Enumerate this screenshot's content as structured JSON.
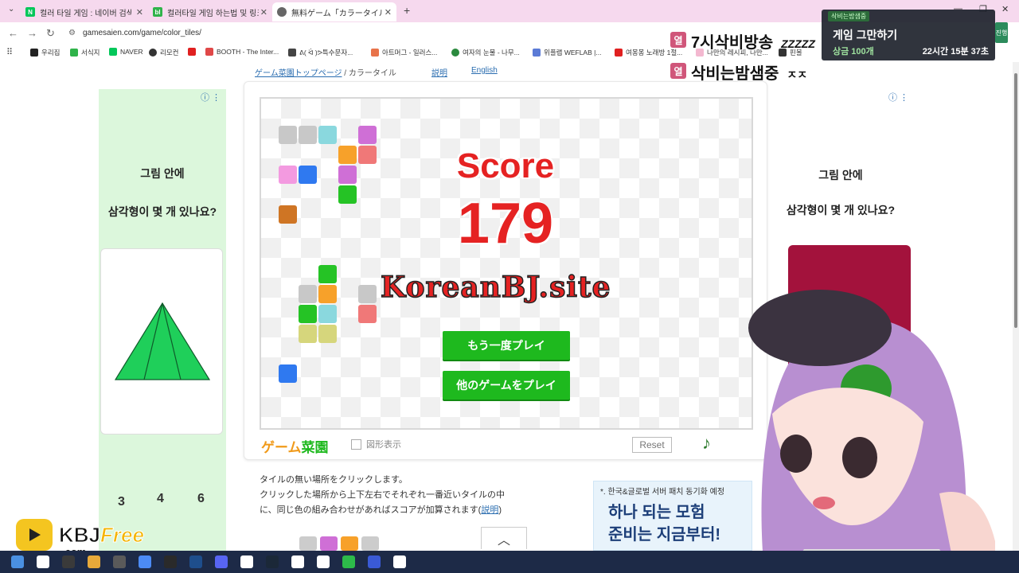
{
  "tabs": [
    {
      "label": "컬러 타일 게임 : 네이버 검색",
      "favicon": "N",
      "color": "#03c75a"
    },
    {
      "label": "컬러타일 게임 하는법 및 링크",
      "favicon": "bl",
      "color": "#2fb34a"
    },
    {
      "label": "無料ゲーム「カラータイル」(パズ",
      "favicon": "",
      "color": "#666666"
    }
  ],
  "new_tab": "+",
  "url": "gamesaien.com/game/color_tiles/",
  "bookmarks": [
    "우리집",
    "서식지",
    "NAVER",
    "리모컨",
    "",
    "BOOTH - The Inter...",
    "ᕕ( ᐛ )ᕗ특수문자...",
    "아트머그 - 일러스...",
    "여자의 눈물 - 나무...",
    "위플랩 WEFLAB |...",
    "여몽몽 노래방 1절...",
    "나만의 레시피, 나만...",
    "핀볼"
  ],
  "page": {
    "breadcrumb_link": "ゲーム菜園トップページ",
    "breadcrumb_sep": " / ",
    "breadcrumb_current": "カラータイル",
    "help_link": "説明",
    "english_link": "English",
    "ad_left": {
      "line1": "그림 안에",
      "line2": "삼각형이 몇 개 있나요?",
      "answers": [
        "3",
        "4",
        "6"
      ]
    },
    "ad_right": {
      "line1": "그림 안에",
      "line2": "삼각형이 몇 개 있나요?"
    },
    "score_label": "Score",
    "score_value": "179",
    "watermark": "KoreanBJ.site",
    "btn_replay": "もう一度プレイ",
    "btn_other": "他のゲームをプレイ",
    "logo_part1": "ゲーム",
    "logo_part2": "菜園",
    "shape_toggle": "図形表示",
    "reset": "Reset",
    "instructions_1": "タイルの無い場所をクリックします。",
    "instructions_2": "クリックした場所から上下左右でそれぞれ一番近いタイルの中",
    "instructions_3": "に、同じ色の組み合わせがあればスコアが加算されます(",
    "instructions_link": "説明",
    "instructions_end": ")",
    "ad_bottom": {
      "line1": "*. 한국&글로벌 서버 패치 동기화 예정",
      "line2": "하나 되는 모험",
      "line3": "준비는 지금부터!"
    }
  },
  "overlay": {
    "tag": "열",
    "line1": "7시삭비방송",
    "line1_suffix": "ZZZZZ",
    "line2": "삭비는밤샘중",
    "line2_suffix": "ㅈㅈ",
    "panel_title": "삭비는밤샘중",
    "panel_main": "게임 그만하기",
    "panel_sub": "상금 100개",
    "panel_time": "22시간 15분 37초",
    "side": "진행",
    "brand": "KBJ",
    "brand_free": "Free",
    "brand_com": ".com"
  },
  "tiles": [
    {
      "c": "#c8c8c8",
      "col": 0,
      "row": 0
    },
    {
      "c": "#c8c8c8",
      "col": 1,
      "row": 0
    },
    {
      "c": "#8ad8de",
      "col": 2,
      "row": 0
    },
    {
      "c": "#cf6fd6",
      "col": 4,
      "row": 0
    },
    {
      "c": "#f7a12a",
      "col": 3,
      "row": 1
    },
    {
      "c": "#f07878",
      "col": 4,
      "row": 1
    },
    {
      "c": "#f39ae0",
      "col": 0,
      "row": 2
    },
    {
      "c": "#2f79f0",
      "col": 1,
      "row": 2
    },
    {
      "c": "#cf6fd6",
      "col": 3,
      "row": 2
    },
    {
      "c": "#25c325",
      "col": 3,
      "row": 3
    },
    {
      "c": "#cf7524",
      "col": 0,
      "row": 4
    },
    {
      "c": "#25c325",
      "col": 2,
      "row": 7
    },
    {
      "c": "#c8c8c8",
      "col": 1,
      "row": 8
    },
    {
      "c": "#f7a12a",
      "col": 2,
      "row": 8
    },
    {
      "c": "#c8c8c8",
      "col": 4,
      "row": 8
    },
    {
      "c": "#25c325",
      "col": 1,
      "row": 9
    },
    {
      "c": "#8ad8de",
      "col": 2,
      "row": 9
    },
    {
      "c": "#f07878",
      "col": 4,
      "row": 9
    },
    {
      "c": "#d6d67c",
      "col": 1,
      "row": 10
    },
    {
      "c": "#d6d67c",
      "col": 2,
      "row": 10
    },
    {
      "c": "#2f79f0",
      "col": 0,
      "row": 12
    }
  ],
  "colors": {
    "accent_green": "#1eb91e",
    "score_red": "#e52222",
    "tab_bg": "#f6d9ee"
  }
}
